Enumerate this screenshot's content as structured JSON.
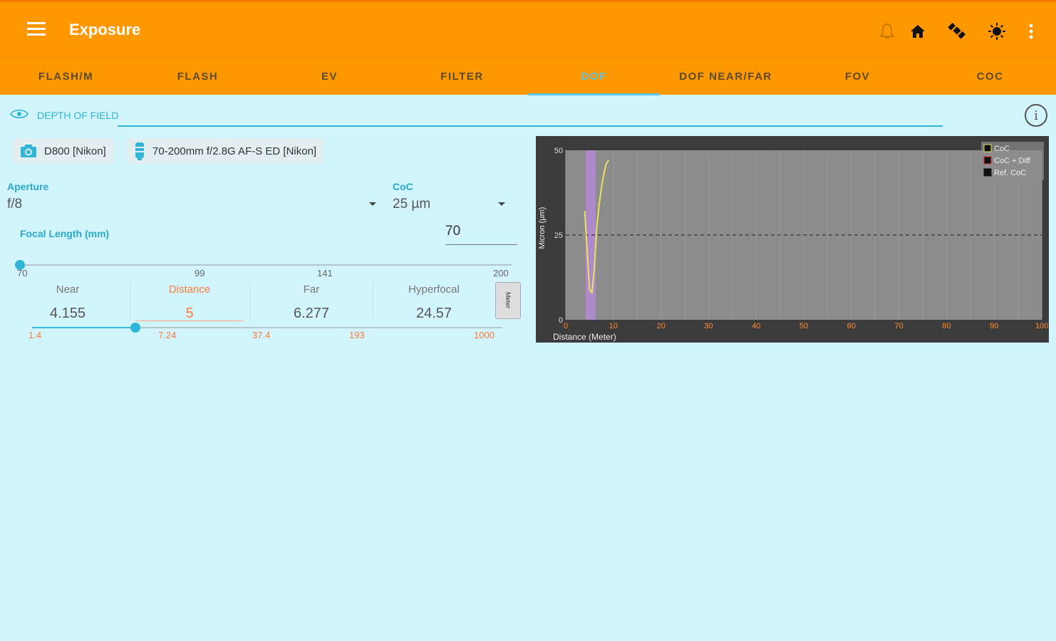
{
  "app": {
    "title": "Exposure"
  },
  "tabs": [
    {
      "label": "FLASH/M"
    },
    {
      "label": "FLASH"
    },
    {
      "label": "EV"
    },
    {
      "label": "FILTER"
    },
    {
      "label": "DOF"
    },
    {
      "label": "DOF NEAR/FAR"
    },
    {
      "label": "FOV"
    },
    {
      "label": "COC"
    }
  ],
  "active_tab": "DOF",
  "section": {
    "title": "DEPTH OF FIELD"
  },
  "camera_chip": "D800 [Nikon]",
  "lens_chip": "70-200mm f/2.8G AF-S ED [Nikon]",
  "aperture": {
    "label": "Aperture",
    "value": "f/8"
  },
  "coc": {
    "label": "CoC",
    "value": "25 µm"
  },
  "focal": {
    "label": "Focal Length (mm)",
    "value": "70",
    "ticks": [
      "70",
      "99",
      "141",
      "200"
    ],
    "fraction": 0.0
  },
  "results": {
    "near": {
      "label": "Near",
      "value": "4.155"
    },
    "distance": {
      "label": "Distance",
      "value": "5"
    },
    "far": {
      "label": "Far",
      "value": "6.277"
    },
    "hyperfocal": {
      "label": "Hyperfocal",
      "value": "24.57"
    }
  },
  "unit_button": "Meter",
  "distance_slider": {
    "ticks": [
      "1.4",
      "7.24",
      "37.4",
      "193",
      "1000"
    ],
    "fraction": 0.22
  },
  "colors": {
    "appbar": "#ff9800",
    "accent": "#30b6d6",
    "highlight": "#ff7a33",
    "background": "#d2f4fc"
  },
  "chart_data": {
    "type": "line",
    "xlabel": "Distance (Meter)",
    "ylabel": "Micron (µm)",
    "xlim": [
      0,
      100
    ],
    "ylim": [
      0,
      50
    ],
    "x_ticks": [
      "0",
      "10",
      "20",
      "30",
      "40",
      "50",
      "60",
      "70",
      "80",
      "90",
      "100"
    ],
    "y_ticks": [
      "0",
      "25",
      "50"
    ],
    "legend": [
      "CoC",
      "CoC + Diff",
      "Ref. CoC"
    ],
    "legend_position": "top-right",
    "grid": true,
    "dof_band": [
      4.155,
      6.277
    ],
    "reference_coc": 25,
    "series": [
      {
        "name": "CoC",
        "color": "#e8e060",
        "x": [
          4.0,
          4.5,
          5.0,
          5.5,
          6.0,
          6.5,
          7.0,
          7.5,
          8.0,
          8.5,
          9.0
        ],
        "y": [
          32,
          20,
          9,
          8,
          15,
          27,
          34,
          39,
          43,
          46,
          47
        ]
      }
    ]
  }
}
